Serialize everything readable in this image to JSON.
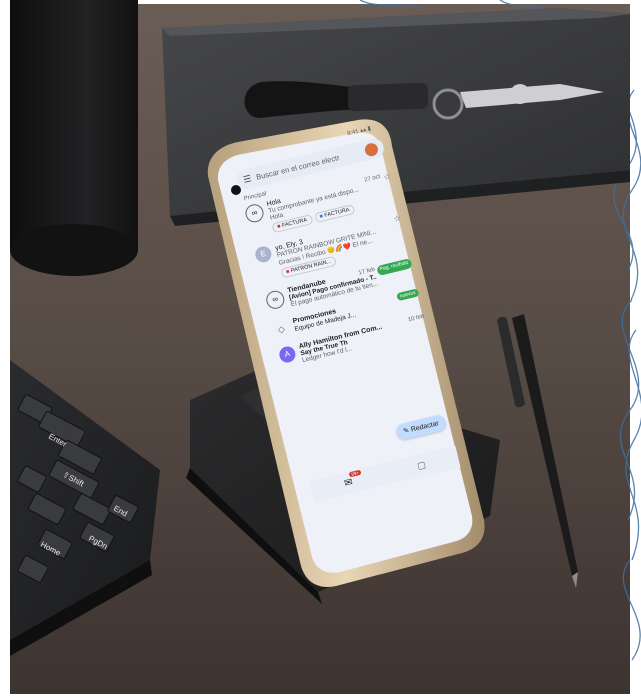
{
  "photo": {
    "subject": "smartphone-on-stand-with-email-app",
    "colors": {
      "desk": "#5a4f49",
      "desk_dark": "#3e3531",
      "notebook": "#3a3b3d",
      "phone_frame": "#d9c3a0",
      "screen_bg": "#eef1f8",
      "accent_red": "#d93025",
      "accent_green": "#34a853",
      "accent_blue": "#c2dcff",
      "swirl_blue": "#3c6fa3"
    }
  },
  "email_app": {
    "search_placeholder": "Buscar en el correo electr",
    "section_label": "Principal",
    "emails": [
      {
        "avatar": "icon",
        "sender": "Hola",
        "date": "27 oct",
        "subject": "Tu comprobante ya está dispo...",
        "snippet": "Hola",
        "attachments": [
          "FACTURA",
          "FACTURA"
        ]
      },
      {
        "avatar": "E",
        "sender": "yo, Ely, 3",
        "date": "",
        "subject": "PATRON RAINBOW GRITE MINI...",
        "snippet": "Gracias ! Recibo 😊🌈❤️ El ne...",
        "attachments": [
          "PATRÓN RAIN..."
        ]
      },
      {
        "avatar": "icon",
        "sender": "Tiendanube",
        "date": "17 feb",
        "subject": "[Avion] Pago confirmado - T...",
        "snippet": "El pago automático de tu tien...",
        "badge": "Pag. recibido"
      },
      {
        "avatar": "icon",
        "sender": "Promociones",
        "date": "",
        "subject": "Equipo de Madeja J...",
        "snippet": "",
        "badge": "nuevos"
      },
      {
        "avatar": "A",
        "sender": "Ally Hamilton from Com...",
        "date": "10 feb",
        "subject": "Say the True Th",
        "snippet": "Ledger how I'd l..."
      }
    ],
    "compose_label": "Redactar",
    "nav_badge": "99+"
  }
}
